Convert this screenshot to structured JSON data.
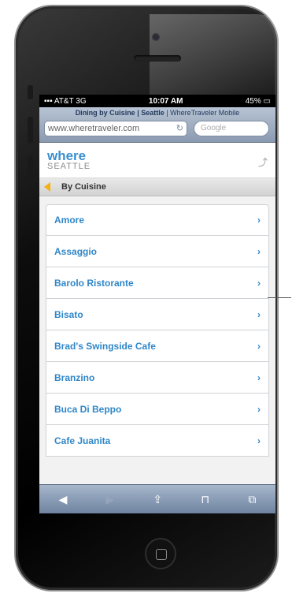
{
  "status_bar": {
    "carrier": "AT&T",
    "network": "3G",
    "time": "10:07 AM",
    "battery": "45%"
  },
  "browser": {
    "page_title_bold": "Dining by Cuisine | Seattle",
    "page_title_rest": "| WhereTraveler Mobile",
    "url": "www.wheretraveler.com",
    "search_placeholder": "Google"
  },
  "site": {
    "logo_word": "where",
    "logo_city": "SEATTLE"
  },
  "breadcrumb": {
    "label": "By Cuisine"
  },
  "restaurants": [
    {
      "name": "Amore"
    },
    {
      "name": "Assaggio"
    },
    {
      "name": "Barolo Ristorante"
    },
    {
      "name": "Bisato"
    },
    {
      "name": "Brad's Swingside Cafe"
    },
    {
      "name": "Branzino"
    },
    {
      "name": "Buca Di Beppo"
    },
    {
      "name": "Cafe Juanita"
    }
  ],
  "icons": {
    "reload": "↻",
    "chevron": "›",
    "back": "◀",
    "forward": "▶",
    "share": "⇪",
    "bookmarks": "📖",
    "tabs": "⧉"
  },
  "colors": {
    "link": "#2f86c8",
    "accent": "#f3b214",
    "toolbar": "#8a9ab0"
  }
}
